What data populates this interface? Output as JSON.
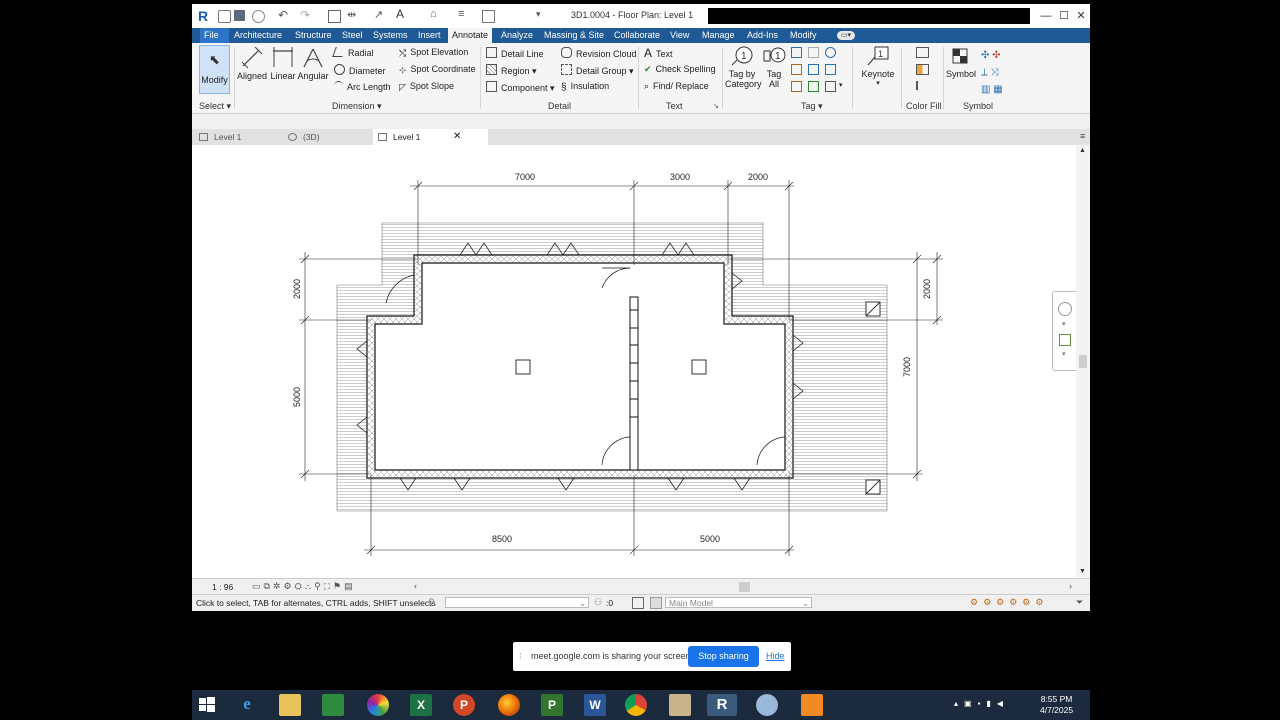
{
  "window": {
    "title": "3D1.0004 - Floor Plan: Level 1",
    "controls": {
      "minimize": "—",
      "maximize": "☐",
      "close": "✕"
    }
  },
  "menu": {
    "tabs": [
      "File",
      "Architecture",
      "Structure",
      "Steel",
      "Systems",
      "Insert",
      "Annotate",
      "Analyze",
      "Massing & Site",
      "Collaborate",
      "View",
      "Manage",
      "Add-Ins",
      "Modify"
    ],
    "active": "Annotate"
  },
  "ribbon": {
    "select": {
      "modify": "Modify",
      "panel": "Select ▾"
    },
    "dimension": {
      "aligned": "Aligned",
      "linear": "Linear",
      "angular": "Angular",
      "radial": "Radial",
      "diameter": "Diameter",
      "arc_length": "Arc Length",
      "spot_elevation": "Spot Elevation",
      "spot_coordinate": "Spot Coordinate",
      "spot_slope": "Spot Slope",
      "panel": "Dimension ▾"
    },
    "detail": {
      "detail_line": "Detail Line",
      "region": "Region ▾",
      "component": "Component ▾",
      "revision_cloud": "Revision Cloud",
      "detail_group": "Detail Group ▾",
      "insulation": "Insulation",
      "panel": "Detail"
    },
    "text": {
      "text": "Text",
      "check_spelling": "Check Spelling",
      "find_replace": "Find/ Replace",
      "panel": "Text"
    },
    "tag": {
      "tag_by_category_1": "Tag by",
      "tag_by_category_2": "Category",
      "tag_all_1": "Tag",
      "tag_all_2": "All",
      "panel": "Tag ▾"
    },
    "keynote": {
      "label": "Keynote"
    },
    "color_fill": {
      "panel": "Color Fill"
    },
    "symbol": {
      "label": "Symbol",
      "panel": "Symbol"
    }
  },
  "view_tabs": [
    {
      "label": "Level 1",
      "active": false
    },
    {
      "label": "(3D)",
      "active": false
    },
    {
      "label": "Level 1",
      "active": true
    }
  ],
  "drawing": {
    "dims_top": [
      "7000",
      "3000",
      "2000"
    ],
    "dims_bottom": [
      "8500",
      "5000"
    ],
    "dims_left": [
      "2000",
      "5000"
    ],
    "dims_right": [
      "2000",
      "7000"
    ]
  },
  "view_control": {
    "scale": "1 : 96"
  },
  "status": {
    "hint": "Click to select, TAB for alternates, CTRL adds, SHIFT unselects",
    "selection_count": ":0",
    "model": "Main Model"
  },
  "share_banner": {
    "text": "meet.google.com is sharing your screen.",
    "stop": "Stop sharing",
    "hide": "Hide"
  },
  "taskbar": {
    "time": "8:55 PM",
    "date": "4/7/2025",
    "apps": [
      "start-icon",
      "internet-explorer-icon",
      "file-explorer-icon",
      "store-icon",
      "picasa-icon",
      "excel-icon",
      "powerpoint-icon",
      "firefox-icon",
      "project-icon",
      "word-icon",
      "chrome-icon",
      "notepad-icon",
      "revit-icon",
      "paint-icon",
      "orange-app-icon"
    ]
  }
}
